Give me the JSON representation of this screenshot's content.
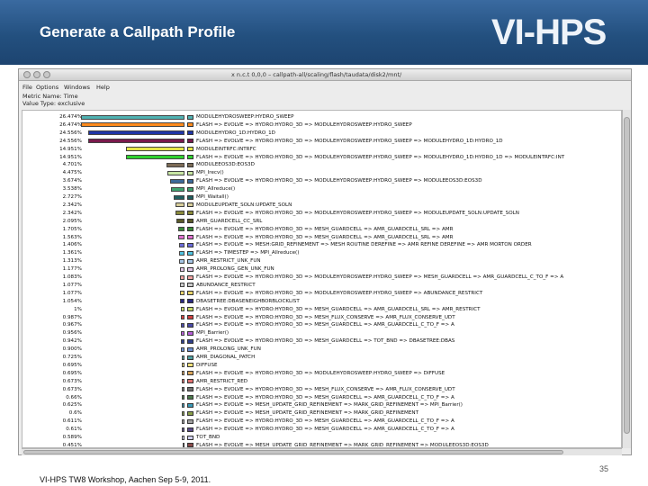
{
  "slide": {
    "title": "Generate a Callpath Profile",
    "logo_text": "VI-HPS",
    "footer": "VI-HPS TW8 Workshop, Aachen Sep 5-9, 2011.",
    "page_number": "35"
  },
  "window": {
    "title": "x  n.c.t 0,0,0 – callpath-all/scaling/flash/taudata/disk2/mnt/",
    "menu": [
      "File",
      "Options",
      "Windows",
      "Help"
    ],
    "metric_name": "Metric Name: Time",
    "value_type": "Value Type: exclusive"
  },
  "profile": {
    "max_percent": 26.474,
    "rows": [
      {
        "percent": "26.474%",
        "value": 26.474,
        "color": "#4fb3b3",
        "label": "MODULEHYDROSWEEP:HYDRO_SWEEP"
      },
      {
        "percent": "26.474%",
        "value": 26.474,
        "color": "#ff8a1c",
        "label": "FLASH   => EVOLVE   => HYDRO:HYDRO_3D   => MODULEHYDROSWEEP:HYDRO_SWEEP"
      },
      {
        "percent": "24.556%",
        "value": 24.556,
        "color": "#1f35a6",
        "label": "MODULEHYDRO_1D:HYDRO_1D"
      },
      {
        "percent": "24.556%",
        "value": 24.556,
        "color": "#7a1a4c",
        "label": "FLASH   => EVOLVE   => HYDRO:HYDRO_3D   => MODULEHYDROSWEEP:HYDRO_SWEEP   => MODULEHYDRO_1D:HYDRO_1D"
      },
      {
        "percent": "14.951%",
        "value": 14.951,
        "color": "#e6e64a",
        "label": "MODULEINTRFC:INTRFC"
      },
      {
        "percent": "14.951%",
        "value": 14.951,
        "color": "#2fd12f",
        "label": "FLASH   => EVOLVE   => HYDRO:HYDRO_3D   => MODULEHYDROSWEEP:HYDRO_SWEEP   => MODULEHYDRO_1D:HYDRO_1D   => MODULEINTRFC:INT"
      },
      {
        "percent": "4.701%",
        "value": 4.701,
        "color": "#7b6a55",
        "label": "MODULEEOS3D:EOS3D"
      },
      {
        "percent": "4.475%",
        "value": 4.475,
        "color": "#c7e6a3",
        "label": "MPI_Irecv()"
      },
      {
        "percent": "3.674%",
        "value": 3.674,
        "color": "#3c6a9a",
        "label": "FLASH   => EVOLVE   => HYDRO:HYDRO_3D   => MODULEHYDROSWEEP:HYDRO_SWEEP   => MODULEEOS3D:EOS3D"
      },
      {
        "percent": "3.538%",
        "value": 3.538,
        "color": "#3fa36f",
        "label": "MPI_Allreduce()"
      },
      {
        "percent": "2.727%",
        "value": 2.727,
        "color": "#1f5f5f",
        "label": "MPI_Waitall()"
      },
      {
        "percent": "2.342%",
        "value": 2.342,
        "color": "#d7cd9a",
        "label": "MODULEUPDATE_SOLN:UPDATE_SOLN"
      },
      {
        "percent": "2.342%",
        "value": 2.342,
        "color": "#8a8a3a",
        "label": "FLASH   => EVOLVE   => HYDRO:HYDRO_3D   => MODULEHYDROSWEEP:HYDRO_SWEEP   => MODULEUPDATE_SOLN:UPDATE_SOLN"
      },
      {
        "percent": "2.095%",
        "value": 2.095,
        "color": "#5a5a2a",
        "label": "AMR_GUARDCELL_CC_SRL"
      },
      {
        "percent": "1.705%",
        "value": 1.705,
        "color": "#3a8a3a",
        "label": "FLASH   => EVOLVE   => HYDRO:HYDRO_3D   => MESH_GUARDCELL   => AMR_GUARDCELL_SRL   => AMR"
      },
      {
        "percent": "1.563%",
        "value": 1.563,
        "color": "#e06fd0",
        "label": "FLASH   => EVOLVE   => HYDRO:HYDRO_3D   => MESH_GUARDCELL   => AMR_GUARDCELL_SRL   => AMR"
      },
      {
        "percent": "1.406%",
        "value": 1.406,
        "color": "#6a6ad8",
        "label": "FLASH   => EVOLVE   => MESH:GRID_REFINEMENT   => MESH ROUTINE DEREFINE   => AMR REFINE DEREFINE   => AMR MORTON ORDER"
      },
      {
        "percent": "1.361%",
        "value": 1.361,
        "color": "#4fc3e0",
        "label": "FLASH   => TIMESTEP   => MPI_Allreduce()"
      },
      {
        "percent": "1.313%",
        "value": 1.313,
        "color": "#a7c6e6",
        "label": "AMR_RESTRICT_UNK_FUN"
      },
      {
        "percent": "1.177%",
        "value": 1.177,
        "color": "#e3c5e8",
        "label": "AMR_PROLONG_GEN_UNK_FUN"
      },
      {
        "percent": "1.083%",
        "value": 1.083,
        "color": "#f2a3a3",
        "label": "FLASH   => EVOLVE   => HYDRO:HYDRO_3D   => MODULEHYDROSWEEP:HYDRO_SWEEP   => MESH_GUARDCELL   => AMR_GUARDCELL_C_TO_F   => A"
      },
      {
        "percent": "1.077%",
        "value": 1.077,
        "color": "#c9c9c9",
        "label": "ABUNDANCE_RESTRICT"
      },
      {
        "percent": "1.077%",
        "value": 1.077,
        "color": "#e8d36a",
        "label": "FLASH   => EVOLVE   => HYDRO:HYDRO_3D   => MODULEHYDROSWEEP:HYDRO_SWEEP   => ABUNDANCE_RESTRICT"
      },
      {
        "percent": "1.054%",
        "value": 1.054,
        "color": "#2a2a80",
        "label": "DBASETREE:DBASENEIGHBORBLOCKLIST"
      },
      {
        "percent": "1%",
        "value": 1.0,
        "color": "#c6d96a",
        "label": "FLASH   => EVOLVE   => HYDRO:HYDRO_3D   => MESH_GUARDCELL   => AMR_GUARDCELL_SRL   => AMR_RESTRICT"
      },
      {
        "percent": "0.987%",
        "value": 0.987,
        "color": "#d04040",
        "label": "FLASH   => EVOLVE   => HYDRO:HYDRO_3D   => MESH_FLUX_CONSERVE   => AMR_FLUX_CONSERVE_UDT"
      },
      {
        "percent": "0.967%",
        "value": 0.967,
        "color": "#4a4aa8",
        "label": "FLASH   => EVOLVE   => HYDRO:HYDRO_3D   => MESH_GUARDCELL   => AMR_GUARDCELL_C_TO_F   => A"
      },
      {
        "percent": "0.956%",
        "value": 0.956,
        "color": "#b65fd6",
        "label": "MPI_Barrier()"
      },
      {
        "percent": "0.942%",
        "value": 0.942,
        "color": "#2f3f8a",
        "label": "FLASH   => EVOLVE   => HYDRO:HYDRO_3D   => MESH_GUARDCELL   => TOT_BND   => DBASETREE:DBAS"
      },
      {
        "percent": "0.900%",
        "value": 0.9,
        "color": "#6b8fd0",
        "label": "AMR_PROLONG_UNK_FUN"
      },
      {
        "percent": "0.725%",
        "value": 0.725,
        "color": "#4fa0a0",
        "label": "AMR_DIAGONAL_PATCH"
      },
      {
        "percent": "0.695%",
        "value": 0.695,
        "color": "#f0e07a",
        "label": "DIFFUSE"
      },
      {
        "percent": "0.695%",
        "value": 0.695,
        "color": "#d9a45a",
        "label": "FLASH   => EVOLVE   => HYDRO:HYDRO_3D   => MODULEHYDROSWEEP:HYDRO_SWEEP   => DIFFUSE"
      },
      {
        "percent": "0.673%",
        "value": 0.673,
        "color": "#e07070",
        "label": "AMR_RESTRICT_RED"
      },
      {
        "percent": "0.673%",
        "value": 0.673,
        "color": "#707070",
        "label": "FLASH   => EVOLVE   => HYDRO:HYDRO_3D   => MESH_FLUX_CONSERVE   => AMR_FLUX_CONSERVE_UDT"
      },
      {
        "percent": "0.66%",
        "value": 0.66,
        "color": "#4a7a4a",
        "label": "FLASH   => EVOLVE   => HYDRO:HYDRO_3D   => MESH_GUARDCELL   => AMR_GUARDCELL_C_TO_F   => A"
      },
      {
        "percent": "0.625%",
        "value": 0.625,
        "color": "#3a9ab8",
        "label": "FLASH   => EVOLVE   => MESH_UPDATE_GRID_REFINEMENT   => MARK_GRID_REFINEMENT   => MPI_Barrier()"
      },
      {
        "percent": "0.6%",
        "value": 0.6,
        "color": "#8aa04a",
        "label": "FLASH   => EVOLVE   => MESH_UPDATE_GRID_REFINEMENT   => MARK_GRID_REFINEMENT"
      },
      {
        "percent": "0.611%",
        "value": 0.611,
        "color": "#a0a0a0",
        "label": "FLASH   => EVOLVE   => HYDRO:HYDRO_3D   => MESH_GUARDCELL   => AMR_GUARDCELL_C_TO_F   => A"
      },
      {
        "percent": "0.61%",
        "value": 0.61,
        "color": "#5a4a8a",
        "label": "FLASH   => EVOLVE   => HYDRO:HYDRO_3D   => MESH_GUARDCELL   => AMR_GUARDCELL_C_TO_F   => A"
      },
      {
        "percent": "0.589%",
        "value": 0.589,
        "color": "#d0d0f0",
        "label": "TOT_BND"
      },
      {
        "percent": "0.451%",
        "value": 0.451,
        "color": "#8a4a4a",
        "label": "FLASH   => EVOLVE   => MESH_UPDATE_GRID_REFINEMENT   => MARK_GRID_REFINEMENT   => MODULEEOS3D:EOS3D"
      }
    ]
  }
}
